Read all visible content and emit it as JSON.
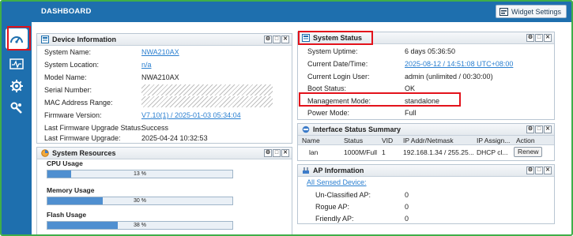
{
  "header": {
    "title": "DASHBOARD",
    "widget_settings": "Widget Settings"
  },
  "sidebar": {
    "items": [
      {
        "icon": "dashboard-gauge-icon"
      },
      {
        "icon": "monitor-pulse-icon"
      },
      {
        "icon": "configuration-gear-icon"
      },
      {
        "icon": "maintenance-tools-icon"
      }
    ]
  },
  "device_info": {
    "title": "Device Information",
    "rows": [
      {
        "label": "System Name:",
        "value": "NWA210AX"
      },
      {
        "label": "System Location:",
        "value": "n/a"
      },
      {
        "label": "Model Name:",
        "value": "NWA210AX"
      },
      {
        "label": "Serial Number:",
        "value": ""
      },
      {
        "label": "MAC Address Range:",
        "value": ""
      },
      {
        "label": "Firmware Version:",
        "value": "V7.10(1) / 2025-01-03 05:34:04"
      },
      {
        "label": "Last Firmware Upgrade Status:",
        "value": "Success"
      },
      {
        "label": "Last Firmware Upgrade:",
        "value": "2025-04-24 10:32:53"
      }
    ]
  },
  "system_resources": {
    "title": "System Resources",
    "items": [
      {
        "label": "CPU Usage",
        "percent": 13,
        "text": "13 %"
      },
      {
        "label": "Memory Usage",
        "percent": 30,
        "text": "30 %"
      },
      {
        "label": "Flash Usage",
        "percent": 38,
        "text": "38 %"
      }
    ]
  },
  "system_status": {
    "title": "System Status",
    "rows": [
      {
        "label": "System Uptime:",
        "value": "6 days 05:36:50"
      },
      {
        "label": "Current Date/Time:",
        "value": "2025-08-12 / 14:51:08 UTC+08:00"
      },
      {
        "label": "Current Login User:",
        "value": "admin (unlimited / 00:30:00)"
      },
      {
        "label": "Boot Status:",
        "value": "OK"
      },
      {
        "label": "Management Mode:",
        "value": "standalone"
      },
      {
        "label": "Power Mode:",
        "value": "Full"
      }
    ]
  },
  "interface_summary": {
    "title": "Interface Status Summary",
    "columns": [
      "Name",
      "Status",
      "VID",
      "IP Addr/Netmask",
      "IP Assign...",
      "Action"
    ],
    "rows": [
      {
        "name": "lan",
        "status": "1000M/Full",
        "vid": "1",
        "ip": "192.168.1.34 / 255.25...",
        "assign": "DHCP cl...",
        "action": "Renew"
      }
    ]
  },
  "ap_info": {
    "title": "AP Information",
    "link": "All Sensed Device:",
    "rows": [
      {
        "label": "Un-Classified AP:",
        "value": "0"
      },
      {
        "label": "Rogue AP:",
        "value": "0"
      },
      {
        "label": "Friendly AP:",
        "value": "0"
      }
    ]
  },
  "panel_controls": [
    "⚙",
    "□",
    "✕"
  ],
  "colors": {
    "sidebar": "#1e6fae",
    "highlight": "#e3121b",
    "link": "#2a7fd0",
    "frame": "#3fae49"
  }
}
